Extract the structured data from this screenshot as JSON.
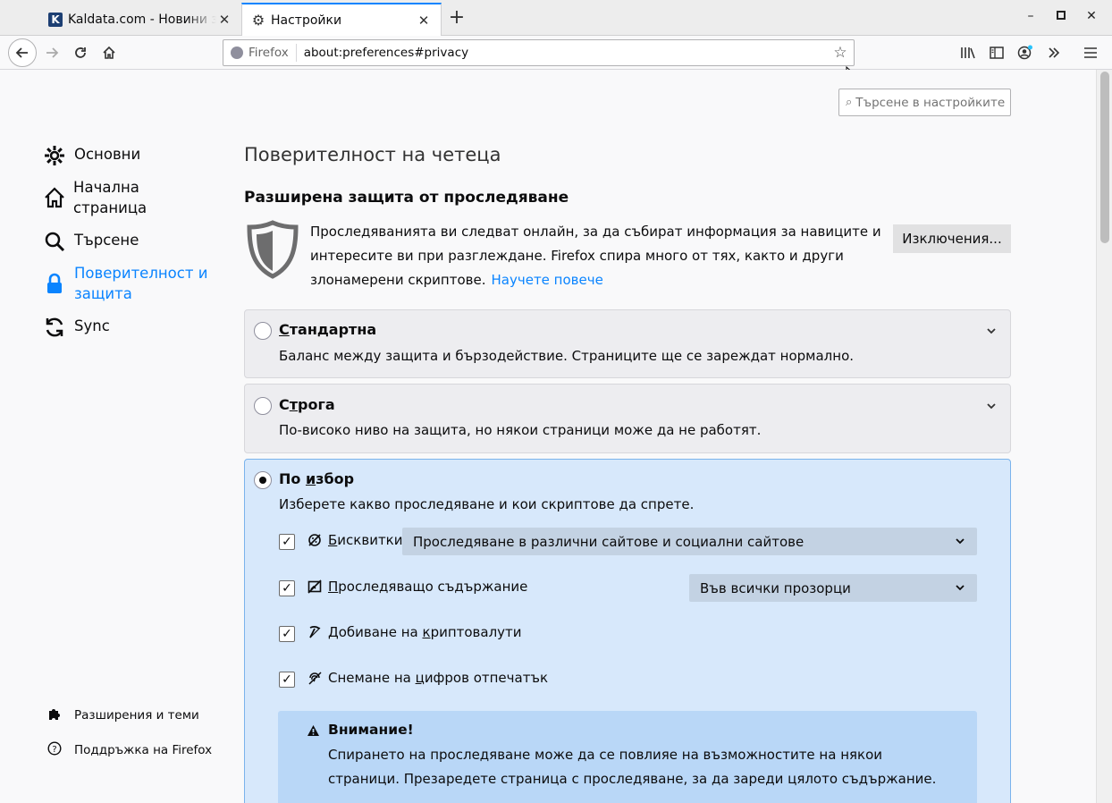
{
  "tabs": [
    {
      "label": "Kaldata.com - Новини за",
      "favicon": "K"
    },
    {
      "label": "Настройки"
    }
  ],
  "window_controls": {
    "minimize": "–",
    "maximize": "▫",
    "close": "✕"
  },
  "urlbar": {
    "identity": "Firefox",
    "url": "about:preferences#privacy"
  },
  "search": {
    "placeholder": "Търсене в настройките"
  },
  "sidebar": {
    "items": [
      {
        "label": "Основни",
        "icon": "gear-icon"
      },
      {
        "label": "Начална страница",
        "icon": "home-icon"
      },
      {
        "label": "Търсене",
        "icon": "search-icon"
      },
      {
        "label": "Поверителност и защита",
        "icon": "lock-icon"
      },
      {
        "label": "Sync",
        "icon": "sync-icon"
      }
    ],
    "footer": [
      {
        "label": "Разширения и теми",
        "icon": "puzzle-icon"
      },
      {
        "label": "Поддръжка на Firefox",
        "icon": "help-icon"
      }
    ]
  },
  "main": {
    "page_title": "Поверителност на четеца",
    "section_title": "Разширена защита от проследяване",
    "description": "Проследяванията ви следват онлайн, за да събират информация за навиците и интересите ви при разглеждане. Firefox спира много от тях, както и други злонамерени скриптове.",
    "learn_more": "Научете повече",
    "exceptions_button": "Изключения...",
    "options": [
      {
        "label_pre": "",
        "label_u": "С",
        "label_post": "тандартна",
        "desc": "Баланс между защита и бързодействие. Страниците ще се зареждат нормално."
      },
      {
        "label_pre": "С",
        "label_u": "т",
        "label_post": "рога",
        "desc": "По-високо ниво на защита, но някои страници може да не работят."
      },
      {
        "label_pre": "По ",
        "label_u": "и",
        "label_post": "збор",
        "desc": "Изберете какво проследяване и кои скриптове да спрете."
      }
    ],
    "custom": {
      "cookies": {
        "label_u": "Б",
        "label_post": "исквитки",
        "select_value": "Проследяване в различни сайтове и социални сайтове"
      },
      "tracking": {
        "label_u": "П",
        "label_post": "роследяващо съдържание",
        "select_value": "Във всички прозорци"
      },
      "crypto": {
        "label_pre": "Добиване на ",
        "label_u": "к",
        "label_post": "риптовалути"
      },
      "fingerprint": {
        "label_pre": "Снемане на ",
        "label_u": "ц",
        "label_post": "ифров отпечатък"
      }
    },
    "warning": {
      "title": "Внимание!",
      "text": "Спирането на проследяване може да се повлияе на възможностите на някои страници. Презаредете страница с проследяване, за да зареди цялото съдържание."
    }
  }
}
